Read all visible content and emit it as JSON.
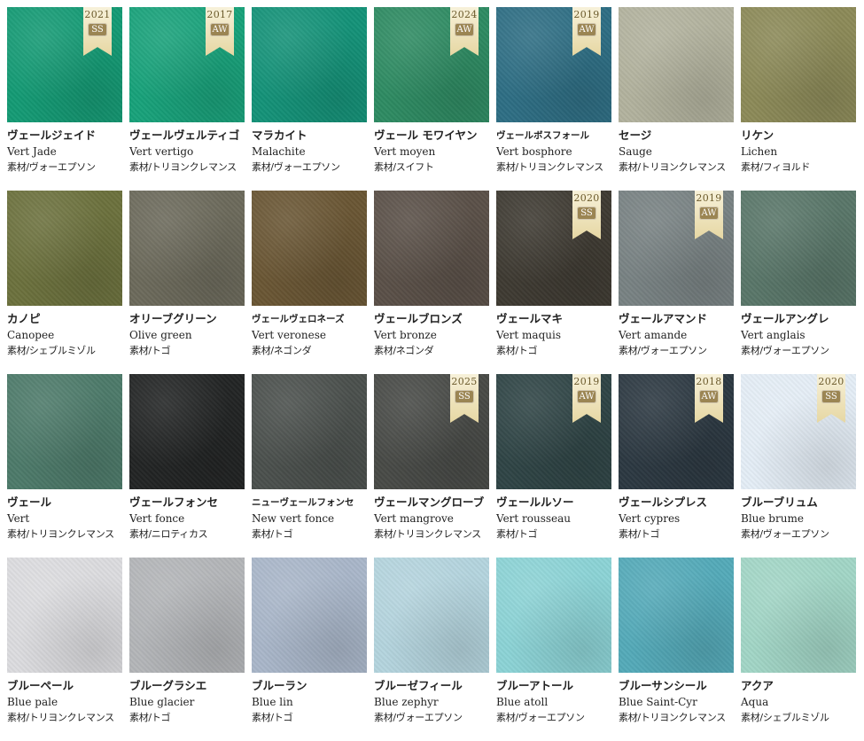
{
  "swatches": [
    {
      "ja": "ヴェールジェイド",
      "en": "Vert Jade",
      "material": "素材/ヴォーエプソン",
      "color": "#149a74",
      "year": "2021",
      "season": "SS"
    },
    {
      "ja": "ヴェールヴェルティゴ",
      "en": "Vert vertigo",
      "material": "素材/トリヨンクレマンス",
      "color": "#18a27a",
      "year": "2017",
      "season": "AW"
    },
    {
      "ja": "マラカイト",
      "en": "Malachite",
      "material": "素材/ヴォーエプソン",
      "color": "#149278",
      "year": "",
      "season": ""
    },
    {
      "ja": "ヴェール モワイヤン",
      "en": "Vert moyen",
      "material": "素材/スイフト",
      "color": "#2e8b62",
      "year": "2024",
      "season": "AW"
    },
    {
      "ja": "ヴェールボスフォール",
      "en": "Vert bosphore",
      "material": "素材/トリヨンクレマンス",
      "color": "#2e6e84",
      "year": "2019",
      "season": "AW"
    },
    {
      "ja": "セージ",
      "en": "Sauge",
      "material": "素材/トリヨンクレマンス",
      "color": "#b2b29e",
      "year": "",
      "season": ""
    },
    {
      "ja": "リケン",
      "en": "Lichen",
      "material": "素材/フィヨルド",
      "color": "#8c8a58",
      "year": "",
      "season": ""
    },
    {
      "ja": "カノピ",
      "en": "Canopee",
      "material": "素材/シェブルミゾル",
      "color": "#6c713d",
      "year": "",
      "season": ""
    },
    {
      "ja": "オリーブグリーン",
      "en": "Olive green",
      "material": "素材/トゴ",
      "color": "#6c6a5b",
      "year": "",
      "season": ""
    },
    {
      "ja": "ヴェールヴェロネーズ",
      "en": "Vert veronese",
      "material": "素材/ネゴンダ",
      "color": "#6a5634",
      "year": "",
      "season": ""
    },
    {
      "ja": "ヴェールブロンズ",
      "en": "Vert bronze",
      "material": "素材/ネゴンダ",
      "color": "#5a5048",
      "year": "",
      "season": ""
    },
    {
      "ja": "ヴェールマキ",
      "en": "Vert maquis",
      "material": "素材/トゴ",
      "color": "#3e3a32",
      "year": "2020",
      "season": "SS"
    },
    {
      "ja": "ヴェールアマンド",
      "en": "Vert amande",
      "material": "素材/ヴォーエプソン",
      "color": "#788283",
      "year": "2019",
      "season": "AW"
    },
    {
      "ja": "ヴェールアングレ",
      "en": "Vert anglais",
      "material": "素材/ヴォーエプソン",
      "color": "#597669",
      "year": "",
      "season": ""
    },
    {
      "ja": "ヴェール",
      "en": "Vert",
      "material": "素材/トリヨンクレマンス",
      "color": "#4d7a6a",
      "year": "",
      "season": ""
    },
    {
      "ja": "ヴェールフォンセ",
      "en": "Vert fonce",
      "material": "素材/ニロティカス",
      "color": "#222424",
      "year": "",
      "season": ""
    },
    {
      "ja": "ニューヴェールフォンセ",
      "en": "New vert fonce",
      "material": "素材/トゴ",
      "color": "#4b504d",
      "year": "",
      "season": ""
    },
    {
      "ja": "ヴェールマングローブ",
      "en": "Vert mangrove",
      "material": "素材/トリヨンクレマンス",
      "color": "#484a46",
      "year": "2025",
      "season": "SS"
    },
    {
      "ja": "ヴェールルソー",
      "en": "Vert rousseau",
      "material": "素材/トゴ",
      "color": "#2f4445",
      "year": "2019",
      "season": "AW"
    },
    {
      "ja": "ヴェールシプレス",
      "en": "Vert cypres",
      "material": "素材/トゴ",
      "color": "#2c3841",
      "year": "2018",
      "season": "AW"
    },
    {
      "ja": "ブルーブリュム",
      "en": "Blue brume",
      "material": "素材/ヴォーエプソン",
      "color": "#e4edf6",
      "year": "2020",
      "season": "SS"
    },
    {
      "ja": "ブルーペール",
      "en": "Blue pale",
      "material": "素材/トリヨンクレマンス",
      "color": "#dcdcdf",
      "year": "",
      "season": ""
    },
    {
      "ja": "ブルーグラシエ",
      "en": "Blue glacier",
      "material": "素材/トゴ",
      "color": "#b3b5b8",
      "year": "",
      "season": ""
    },
    {
      "ja": "ブルーラン",
      "en": "Blue lin",
      "material": "素材/トゴ",
      "color": "#a9b6c9",
      "year": "",
      "season": ""
    },
    {
      "ja": "ブルーゼフィール",
      "en": "Blue zephyr",
      "material": "素材/ヴォーエプソン",
      "color": "#b4d4de",
      "year": "",
      "season": ""
    },
    {
      "ja": "ブルーアトール",
      "en": "Blue atoll",
      "material": "素材/ヴォーエプソン",
      "color": "#8cd3d6",
      "year": "",
      "season": ""
    },
    {
      "ja": "ブルーサンシール",
      "en": "Blue Saint-Cyr",
      "material": "素材/トリヨンクレマンス",
      "color": "#54aab9",
      "year": "",
      "season": ""
    },
    {
      "ja": "アクア",
      "en": "Aqua",
      "material": "素材/シェブルミゾル",
      "color": "#a2d6c6",
      "year": "",
      "season": ""
    }
  ]
}
